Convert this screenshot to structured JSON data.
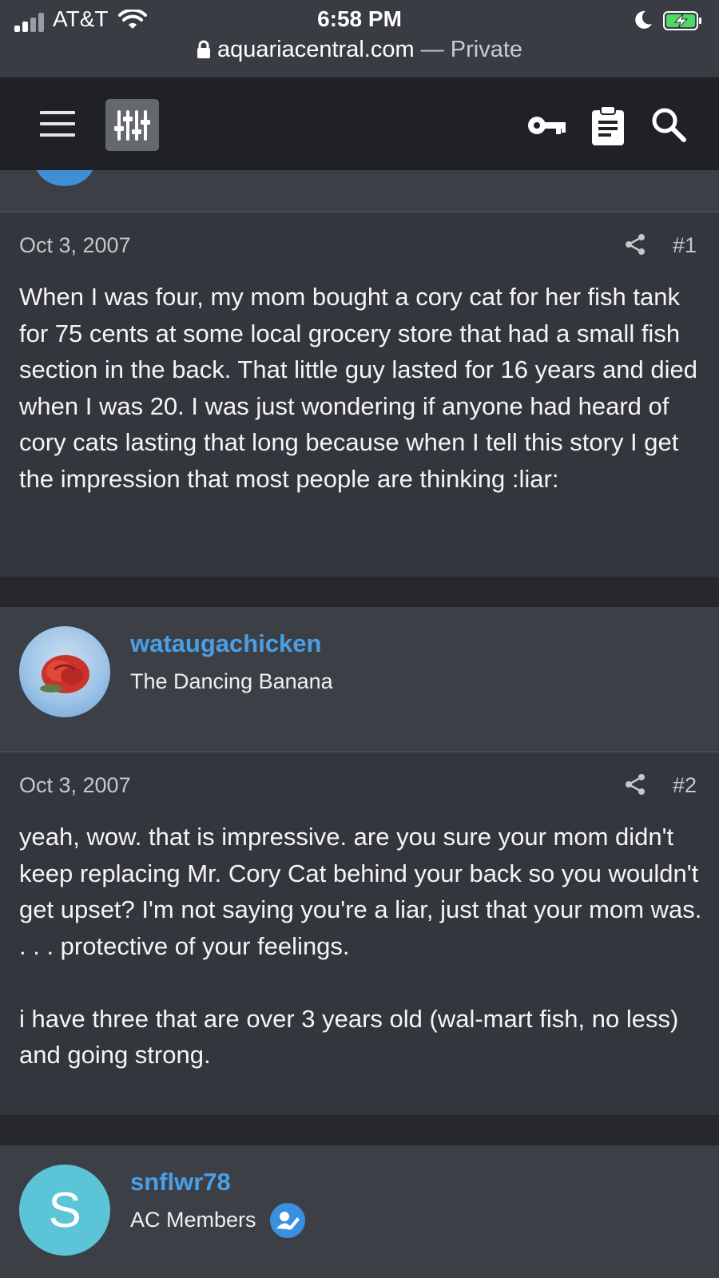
{
  "status_bar": {
    "carrier": "AT&T",
    "time": "6:58 PM",
    "signal_bars": 2,
    "charging": true
  },
  "url_bar": {
    "domain": "aquariacentral.com",
    "separator": " — ",
    "mode": "Private"
  },
  "header": {
    "icons": [
      "menu-icon",
      "filter-icon",
      "key-icon",
      "clipboard-icon",
      "search-icon"
    ]
  },
  "posts": [
    {
      "date": "Oct 3, 2007",
      "number": "#1",
      "text": "When I was four, my mom bought a cory cat for her fish tank for 75 cents at some local grocery store that had a small fish section in the back. That little guy lasted for 16 years and died when I was 20. I was just wondering if anyone had heard of cory cats lasting that long because when I tell this story I get the impression that most people are thinking :liar:"
    },
    {
      "username": "wataugachicken",
      "user_title": "The Dancing Banana",
      "date": "Oct 3, 2007",
      "number": "#2",
      "text": "yeah, wow. that is impressive. are you sure your mom didn't keep replacing Mr. Cory Cat behind your back so you wouldn't get upset? I'm not saying you're a liar, just that your mom was. . . . protective of your feelings.\n\ni have three that are over 3 years old (wal-mart fish, no less) and going strong."
    },
    {
      "username": "snflwr78",
      "user_title": "AC Members",
      "avatar_letter": "S",
      "avatar_color": "#5bc4d6"
    }
  ],
  "colors": {
    "accent_link": "#4a9fe6",
    "header_bg": "#1f2126",
    "post_bg": "#34363d"
  }
}
